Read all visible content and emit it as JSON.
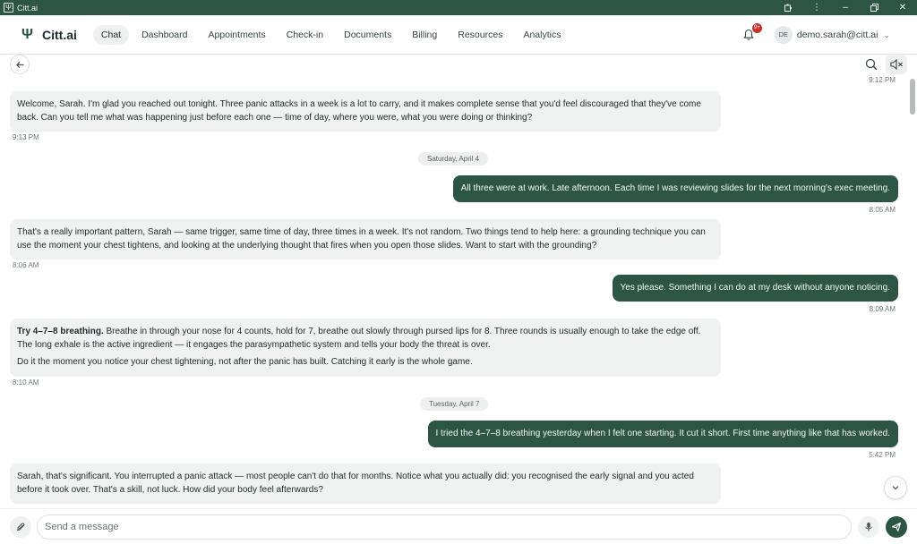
{
  "window": {
    "title": "Citt.ai",
    "controls": [
      "extensions-icon",
      "more-vert-icon",
      "minimize-icon",
      "restore-icon",
      "close-icon"
    ]
  },
  "nav": {
    "logo_text": "Citt.ai",
    "items": [
      "Chat",
      "Dashboard",
      "Appointments",
      "Check-in",
      "Documents",
      "Billing",
      "Resources",
      "Analytics"
    ],
    "active": "Chat",
    "notification_badge": "9+",
    "avatar_initials": "DE",
    "user_email": "demo.sarah@citt.ai"
  },
  "chat": {
    "partial_top_time": "9:12 PM",
    "messages": [
      {
        "role": "assistant",
        "paragraphs": [
          "Welcome, Sarah. I'm glad you reached out tonight. Three panic attacks in a week is a lot to carry, and it makes complete sense that you'd feel discouraged that they've come back. Can you tell me what was happening just before each one — time of day, where you were, what you were doing or thinking?"
        ],
        "time": "9:13 PM"
      },
      {
        "role": "date",
        "label": "Saturday, April 4"
      },
      {
        "role": "user",
        "text": "All three were at work. Late afternoon. Each time I was reviewing slides for the next morning's exec meeting.",
        "time": "8:05 AM"
      },
      {
        "role": "assistant",
        "paragraphs": [
          "That's a really important pattern, Sarah — same trigger, same time of day, three times in a week. It's not random. Two things tend to help here: a grounding technique you can use the moment your chest tightens, and looking at the underlying thought that fires when you open those slides. Want to start with the grounding?"
        ],
        "time": "8:06 AM"
      },
      {
        "role": "user",
        "text": "Yes please. Something I can do at my desk without anyone noticing.",
        "time": "8:09 AM"
      },
      {
        "role": "assistant",
        "bold_lead": "Try 4–7–8 breathing.",
        "paragraphs": [
          " Breathe in through your nose for 4 counts, hold for 7, breathe out slowly through pursed lips for 8. Three rounds is usually enough to take the edge off. The long exhale is the active ingredient — it engages the parasympathetic system and tells your body the threat is over.",
          "Do it the moment you notice your chest tightening, not after the panic has built. Catching it early is the whole game."
        ],
        "time": "8:10 AM"
      },
      {
        "role": "date",
        "label": "Tuesday, April 7"
      },
      {
        "role": "user",
        "text": "I tried the 4–7–8 breathing yesterday when I felt one starting. It cut it short. First time anything like that has worked.",
        "time": "5:42 PM"
      },
      {
        "role": "assistant",
        "paragraphs": [
          "Sarah, that's significant. You interrupted a panic attack — most people can't do that for months. Notice what you actually did: you recognised the early signal and you acted before it took over. That's a skill, not luck. How did your body feel afterwards?"
        ]
      }
    ]
  },
  "composer": {
    "placeholder": "Send a message"
  }
}
